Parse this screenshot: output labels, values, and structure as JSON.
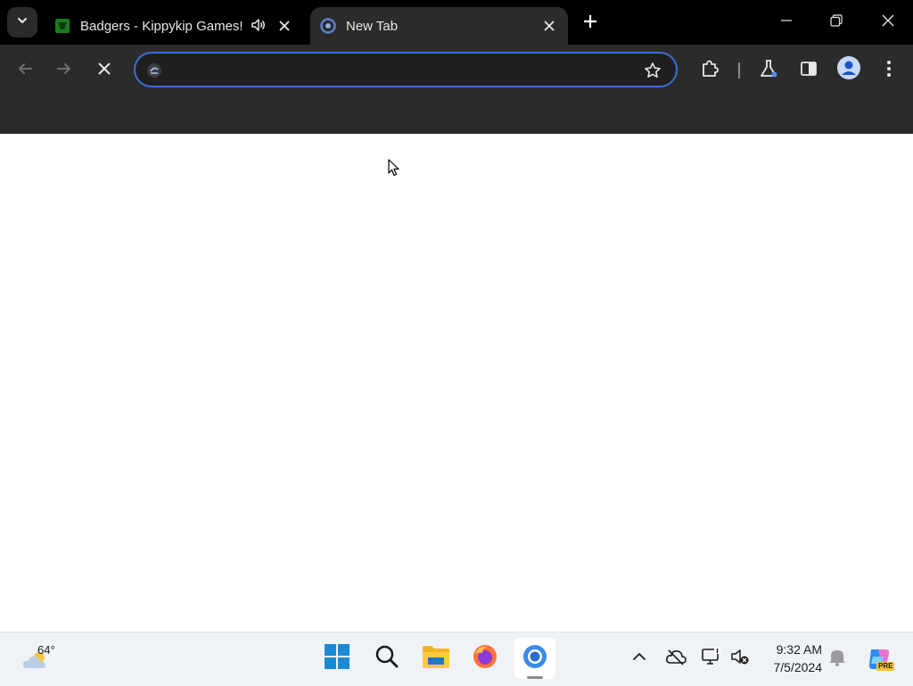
{
  "browser": {
    "tabs": [
      {
        "title": "Badgers - Kippykip Games!",
        "favicon": "green-game-icon",
        "audio": true,
        "active": false
      },
      {
        "title": "New Tab",
        "favicon": "loading-spinner-icon",
        "active": true
      }
    ],
    "omnibox": {
      "value": "",
      "placeholder": ""
    }
  },
  "taskbar": {
    "weather": {
      "temp": "64°"
    },
    "apps": [
      "windows-start",
      "search",
      "file-explorer",
      "firefox",
      "chrome"
    ],
    "clock": {
      "time": "9:32 AM",
      "date": "7/5/2024"
    },
    "copilot_badge": "PRE"
  },
  "colors": {
    "tabstrip": "#000000",
    "toolbar": "#2b2b2b",
    "omnibox_border": "#3b6fd8",
    "taskbar": "#f0f3f6"
  }
}
